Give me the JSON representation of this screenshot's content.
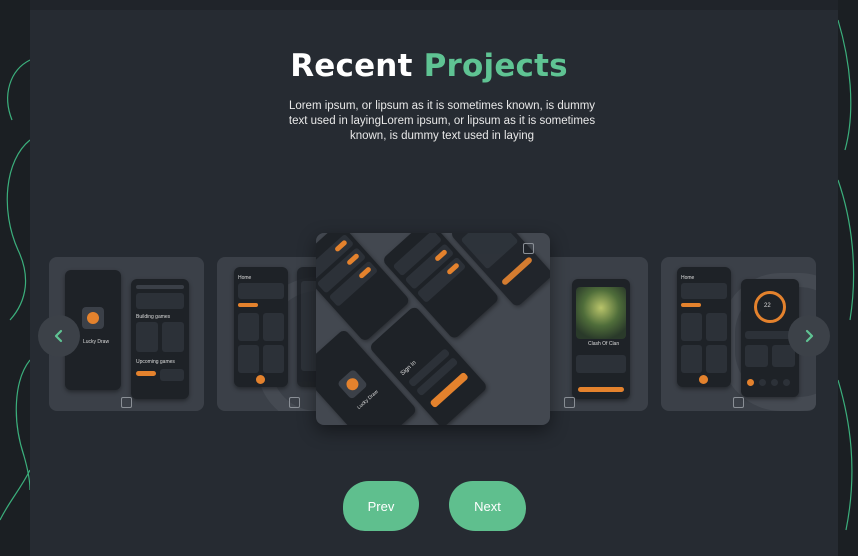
{
  "header": {
    "title_main": "Recent",
    "title_accent": "Projects",
    "description": "Lorem ipsum, or lipsum as it is sometimes known, is dummy text used in layingLorem ipsum, or lipsum as it is sometimes known, is dummy text used in laying"
  },
  "carousel": {
    "prev_arrow_icon": "chevron-left-icon",
    "next_arrow_icon": "chevron-right-icon",
    "cards": [
      {
        "app_name": "Lucky Draw",
        "screen_label": "Home",
        "section_label": "Building games",
        "upcoming": "Upcoming games"
      },
      {
        "screen_label": "Home"
      },
      {
        "app_name": "Lucky Draw",
        "sign_in": "Sign In"
      },
      {
        "game_title": "Clash Of Clan"
      },
      {
        "screen_label": "Home",
        "value": "22"
      }
    ]
  },
  "controls": {
    "prev_label": "Prev",
    "next_label": "Next"
  },
  "colors": {
    "accent_green": "#5fc393",
    "accent_orange": "#e4822d",
    "panel": "#262b32"
  }
}
